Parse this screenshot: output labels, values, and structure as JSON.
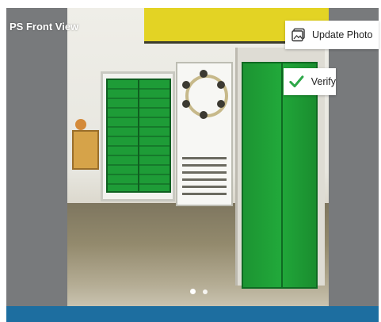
{
  "title": "PS Front View",
  "actions": {
    "update_label": "Update Photo",
    "verify_label": "Verify"
  },
  "icons": {
    "update": "photo-update-icon",
    "verify": "checkmark-icon"
  },
  "carousel": {
    "current": 1,
    "total": 2
  },
  "colors": {
    "accent_bar": "#1d6ea0",
    "check": "#2fa84a",
    "overlay_gray": "#787a7c"
  }
}
